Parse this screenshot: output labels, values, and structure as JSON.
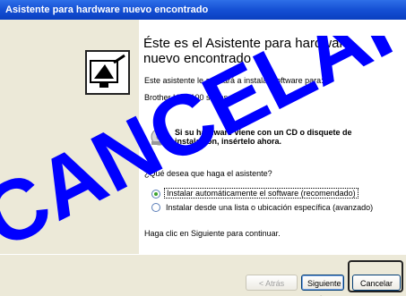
{
  "window": {
    "title": "Asistente para hardware nuevo encontrado"
  },
  "main": {
    "heading_line1": "Éste es el Asistente para hardware",
    "heading_line2": "nuevo encontrado",
    "intro": "Este asistente le ayudará a instalar software para:",
    "device": "Brother  HL-5100 series",
    "cd_line1": "Si su hardware viene con un CD o disquete de",
    "cd_line2": "instalación, insértelo ahora.",
    "question": "¿Qué desea que haga el asistente?",
    "options": [
      {
        "label": "Instalar automáticamente el software (recomendado)",
        "selected": true
      },
      {
        "label": "Instalar desde una lista o ubicación específica (avanzado)",
        "selected": false
      }
    ],
    "continue_text": "Haga clic en Siguiente para continuar."
  },
  "buttons": {
    "back": "< Atrás",
    "next": "Siguiente >",
    "cancel": "Cancelar"
  },
  "watermark": {
    "text": "CANCELAR",
    "color": "#0000FF"
  },
  "colors": {
    "titlebar": "#1550D4",
    "radio_selected": "#3BA22E"
  }
}
